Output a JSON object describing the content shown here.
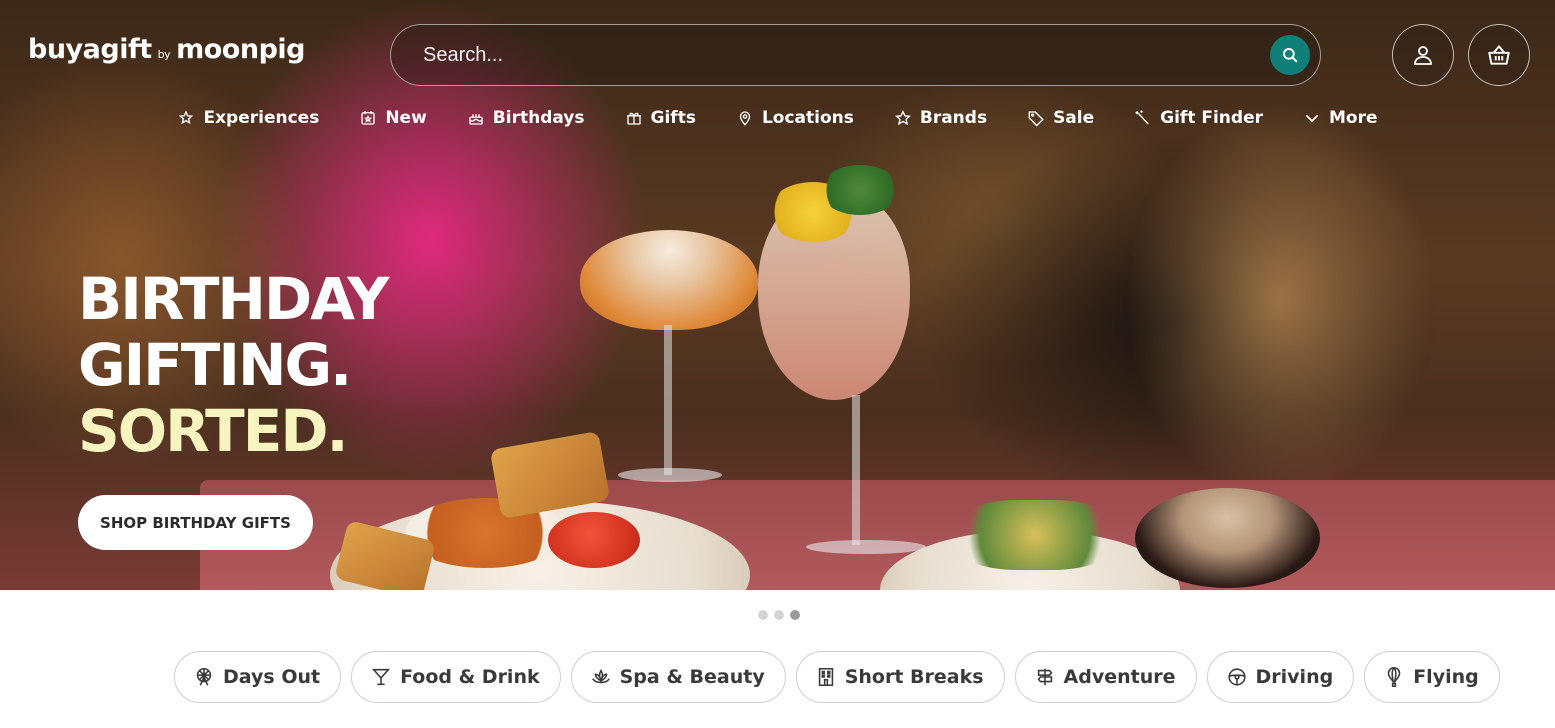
{
  "brand": {
    "name": "buyagift",
    "by": "by",
    "partner": "moonpig"
  },
  "search": {
    "placeholder": "Search..."
  },
  "header": {
    "account_icon": "user-icon",
    "basket_icon": "basket-icon"
  },
  "nav": [
    {
      "label": "Experiences",
      "icon": "sparkle-star-icon"
    },
    {
      "label": "New",
      "icon": "calendar-star-icon"
    },
    {
      "label": "Birthdays",
      "icon": "cake-icon"
    },
    {
      "label": "Gifts",
      "icon": "gift-icon"
    },
    {
      "label": "Locations",
      "icon": "location-pin-icon"
    },
    {
      "label": "Brands",
      "icon": "star-icon"
    },
    {
      "label": "Sale",
      "icon": "tag-icon"
    },
    {
      "label": "Gift Finder",
      "icon": "magic-wand-icon"
    },
    {
      "label": "More",
      "icon": "chevron-down-icon"
    }
  ],
  "hero": {
    "line1": "BIRTHDAY",
    "line2": "GIFTING.",
    "line3": "SORTED.",
    "cta": "SHOP BIRTHDAY GIFTS",
    "accent_color": "#f8f4c0"
  },
  "carousel": {
    "total": 3,
    "active": 3
  },
  "categories": [
    {
      "label": "Days Out",
      "icon": "ferris-wheel-icon"
    },
    {
      "label": "Food & Drink",
      "icon": "cocktail-icon"
    },
    {
      "label": "Spa & Beauty",
      "icon": "lotus-icon"
    },
    {
      "label": "Short Breaks",
      "icon": "hotel-icon"
    },
    {
      "label": "Adventure",
      "icon": "signpost-icon"
    },
    {
      "label": "Driving",
      "icon": "steering-wheel-icon"
    },
    {
      "label": "Flying",
      "icon": "hot-air-balloon-icon"
    }
  ],
  "colors": {
    "search_button": "#0f7f78",
    "text_dark": "#3a3a3a",
    "pill_border": "#cfcfcf"
  }
}
